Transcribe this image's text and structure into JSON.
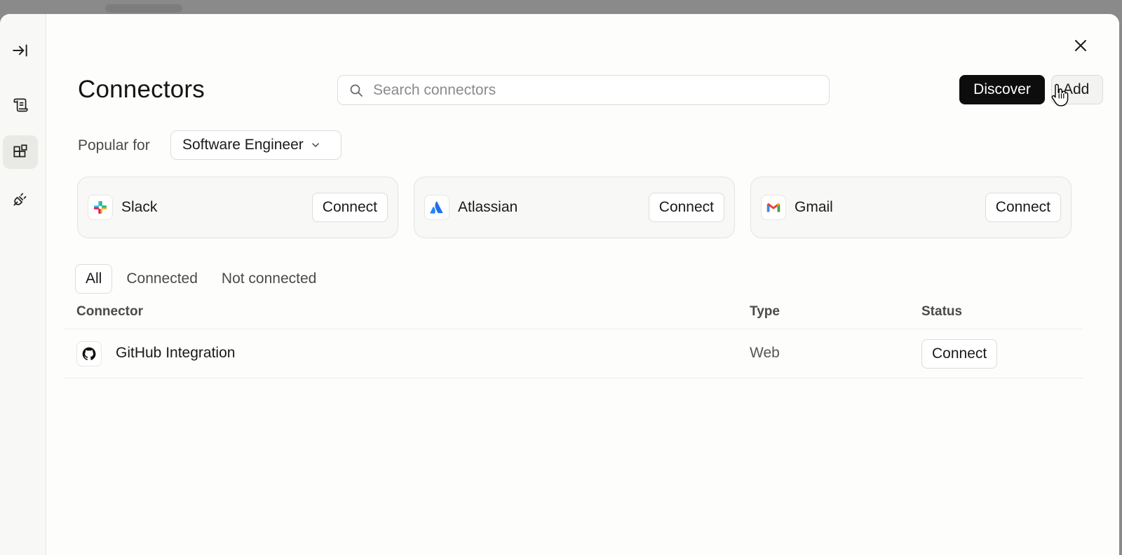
{
  "sidebar": {
    "items": [
      {
        "name": "collapse",
        "icon": "collapse-panel-icon"
      },
      {
        "name": "scroll",
        "icon": "scroll-icon"
      },
      {
        "name": "connectors",
        "icon": "blocks-icon",
        "active": true
      },
      {
        "name": "plug",
        "icon": "plug-icon"
      }
    ]
  },
  "header": {
    "title": "Connectors",
    "close_icon": "close-icon"
  },
  "search": {
    "placeholder": "Search connectors",
    "value": ""
  },
  "toolbar": {
    "discover_label": "Discover",
    "add_label": "Add"
  },
  "popular": {
    "label": "Popular for",
    "selected_role": "Software Engineer"
  },
  "featured": [
    {
      "name": "Slack",
      "icon": "slack-icon",
      "action": "Connect"
    },
    {
      "name": "Atlassian",
      "icon": "atlassian-icon",
      "action": "Connect"
    },
    {
      "name": "Gmail",
      "icon": "gmail-icon",
      "action": "Connect"
    }
  ],
  "filters": {
    "tabs": [
      "All",
      "Connected",
      "Not connected"
    ],
    "active": "All"
  },
  "table": {
    "columns": [
      "Connector",
      "Type",
      "Status"
    ],
    "rows": [
      {
        "name": "GitHub Integration",
        "type": "Web",
        "status": "Connect",
        "icon": "github-icon"
      }
    ]
  },
  "colors": {
    "accent_dark": "#0d0d0d",
    "border": "#dcdcd8",
    "surface": "#f8f8f6",
    "atlassian_blue": "#1f6feb",
    "gmail_red": "#ea4335"
  }
}
